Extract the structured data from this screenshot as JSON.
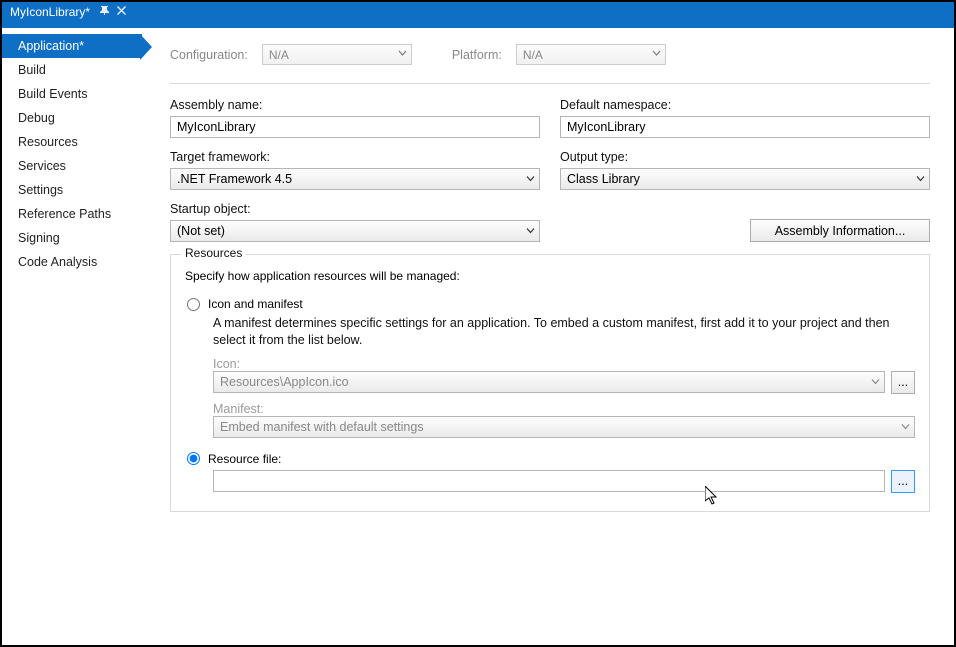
{
  "tab": {
    "title": "MyIconLibrary*",
    "pin": "⇵",
    "close": "✕"
  },
  "sidebar": {
    "items": [
      {
        "label": "Application*",
        "active": true
      },
      {
        "label": "Build",
        "active": false
      },
      {
        "label": "Build Events",
        "active": false
      },
      {
        "label": "Debug",
        "active": false
      },
      {
        "label": "Resources",
        "active": false
      },
      {
        "label": "Services",
        "active": false
      },
      {
        "label": "Settings",
        "active": false
      },
      {
        "label": "Reference Paths",
        "active": false
      },
      {
        "label": "Signing",
        "active": false
      },
      {
        "label": "Code Analysis",
        "active": false
      }
    ]
  },
  "config": {
    "configuration_label": "Configuration:",
    "configuration_value": "N/A",
    "platform_label": "Platform:",
    "platform_value": "N/A"
  },
  "form": {
    "assembly_name_label": "Assembly name:",
    "assembly_name_value": "MyIconLibrary",
    "default_namespace_label": "Default namespace:",
    "default_namespace_value": "MyIconLibrary",
    "target_framework_label": "Target framework:",
    "target_framework_value": ".NET Framework 4.5",
    "output_type_label": "Output type:",
    "output_type_value": "Class Library",
    "startup_object_label": "Startup object:",
    "startup_object_value": "(Not set)",
    "assembly_info_button": "Assembly Information..."
  },
  "resources": {
    "group_title": "Resources",
    "subtitle": "Specify how application resources will be managed:",
    "icon_manifest_option": "Icon and manifest",
    "icon_manifest_help": "A manifest determines specific settings for an application. To embed a custom manifest, first add it to your project and then select it from the list below.",
    "icon_label": "Icon:",
    "icon_value": "Resources\\AppIcon.ico",
    "icon_browse": "...",
    "manifest_label": "Manifest:",
    "manifest_value": "Embed manifest with default settings",
    "resource_file_option": "Resource file:",
    "resource_file_value": "",
    "resource_file_browse": "..."
  }
}
